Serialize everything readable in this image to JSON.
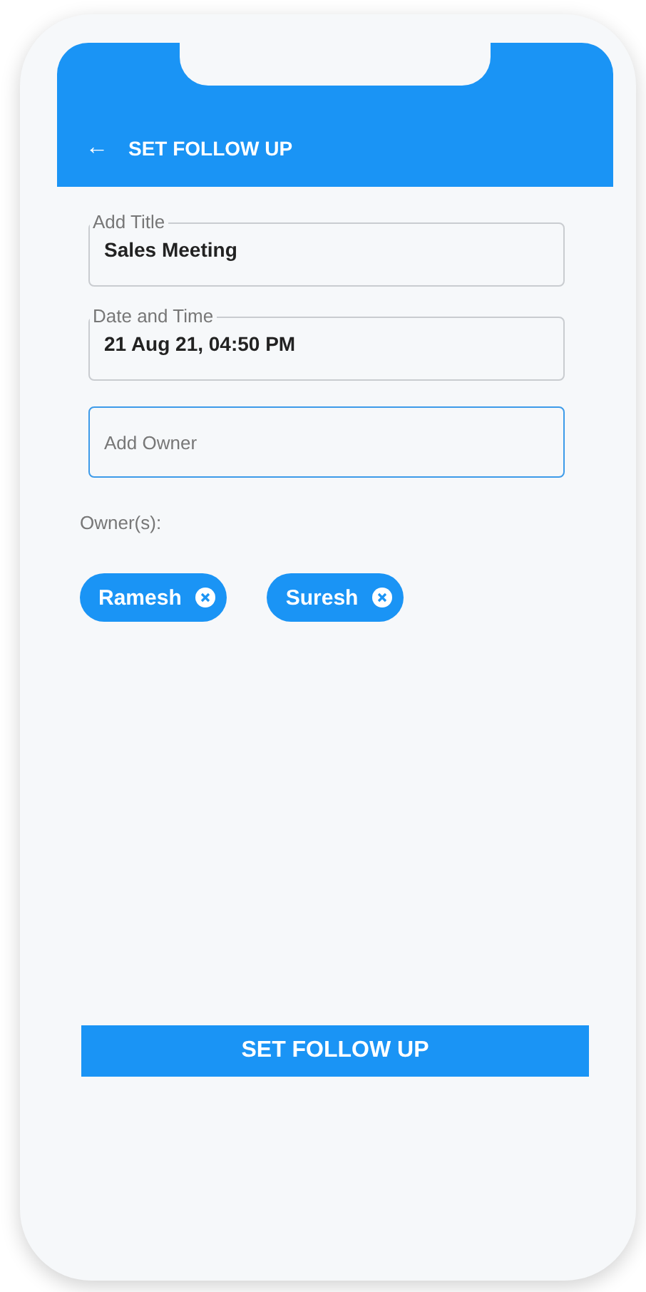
{
  "header": {
    "back_icon": "←",
    "title": "SET FOLLOW UP"
  },
  "fields": [
    {
      "label": "Add Title",
      "value": "Sales Meeting",
      "focused": false
    },
    {
      "label": "Date and Time",
      "value": "21 Aug 21, 04:50 PM",
      "focused": false
    },
    {
      "placeholder": "Add Owner",
      "focused": true
    }
  ],
  "owners_label": "Owner(s):",
  "owners": [
    {
      "name": "Ramesh"
    },
    {
      "name": "Suresh"
    }
  ],
  "submit_button": "SET FOLLOW UP"
}
